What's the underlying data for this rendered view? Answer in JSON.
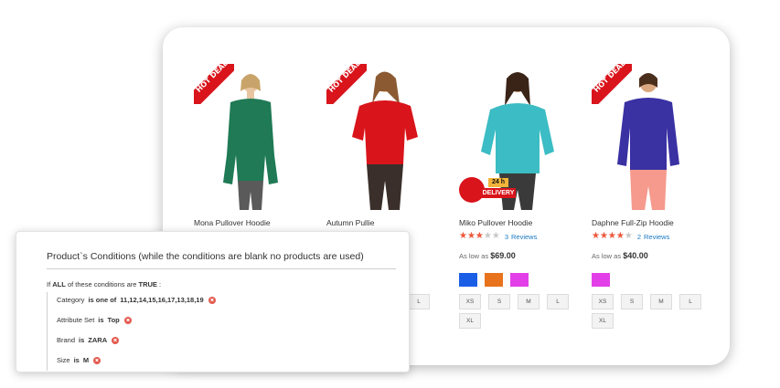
{
  "products": [
    {
      "name": "Mona Pullover Hoodie",
      "badge": "HOT DEAL",
      "shirt_color": "#1f7a55",
      "pants_color": "#5a5a5a",
      "hair_color": "#c9a46a"
    },
    {
      "name": "Autumn Pullie",
      "badge": "HOT DEAL",
      "shirt_color": "#d9141b",
      "pants_color": "#3a2f2a",
      "hair_color": "#8b5a33"
    },
    {
      "name": "Miko Pullover Hoodie",
      "delivery_top": "24 h",
      "delivery_bottom": "DELIVERY",
      "rating": 3,
      "rating_max": 5,
      "review_count": "3",
      "review_label": "Reviews",
      "price_prefix": "As low as",
      "price": "$69.00",
      "swatches": [
        "#1b5ee6",
        "#e8731c",
        "#e23fe8"
      ],
      "sizes": [
        "XS",
        "S",
        "M",
        "L",
        "XL"
      ],
      "shirt_color": "#3cbcc4",
      "pants_color": "#3a3a3a",
      "hair_color": "#3a2418"
    },
    {
      "name": "Daphne Full-Zip Hoodie",
      "badge": "HOT DEAL",
      "rating": 4,
      "rating_max": 5,
      "review_count": "2",
      "review_label": "Reviews",
      "price_prefix": "As low as",
      "price": "$40.00",
      "swatches": [
        "#e23fe8"
      ],
      "sizes": [
        "XS",
        "S",
        "M",
        "L",
        "XL"
      ],
      "shirt_color": "#3a31a3",
      "pants_color": "#f59a8c",
      "hair_color": "#4a2e1c"
    }
  ],
  "partial_size_label": "L",
  "conditions_panel": {
    "title": "Product`s Conditions (while the conditions are blank no products are used)",
    "if_label": "If",
    "aggregator": "ALL",
    "middle": "of these conditions are",
    "value": "TRUE",
    "suffix": ":",
    "conditions": [
      {
        "attribute": "Category",
        "operator": "is one of",
        "value": "11,12,14,15,16,17,13,18,19"
      },
      {
        "attribute": "Attribute Set",
        "operator": "is",
        "value": "Top"
      },
      {
        "attribute": "Brand",
        "operator": "is",
        "value": "ZARA"
      },
      {
        "attribute": "Size",
        "operator": "is",
        "value": "M"
      }
    ]
  },
  "colors": {
    "deal_red": "#d9141b",
    "star_fill": "#f0573a",
    "link_blue": "#1979c3"
  }
}
